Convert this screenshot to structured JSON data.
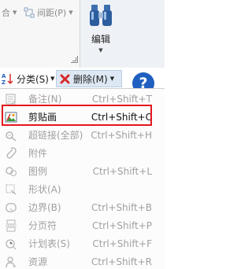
{
  "ribbon": {
    "group_left_label": "合",
    "spacing_label": "间距(P)",
    "edit_label": "编辑"
  },
  "toolbar": {
    "sort_label": "分类(S)",
    "delete_label": "删除(M)",
    "help_label": "?"
  },
  "menu": {
    "items": [
      {
        "label": "备注(N)",
        "shortcut": "Ctrl+Shift+T",
        "icon": "note-icon",
        "enabled": false
      },
      {
        "label": "剪贴画",
        "shortcut": "Ctrl+Shift+C",
        "icon": "clipart-icon",
        "enabled": true
      },
      {
        "label": "超链接(全部)",
        "shortcut": "Ctrl+Shift+H",
        "icon": "hyperlink-icon",
        "enabled": false
      },
      {
        "label": "附件",
        "shortcut": "",
        "icon": "attachment-icon",
        "enabled": false
      },
      {
        "label": "图例",
        "shortcut": "Ctrl+Shift+L",
        "icon": "legend-icon",
        "enabled": false
      },
      {
        "label": "形状(A)",
        "shortcut": "",
        "icon": "shape-icon",
        "enabled": false
      },
      {
        "label": "边界(B)",
        "shortcut": "Ctrl+Shift+B",
        "icon": "boundary-icon",
        "enabled": false
      },
      {
        "label": "分页符",
        "shortcut": "Ctrl+Shift+P",
        "icon": "page-break-icon",
        "enabled": false
      },
      {
        "label": "计划表(S)",
        "shortcut": "Ctrl+Shift+F",
        "icon": "schedule-icon",
        "enabled": false
      },
      {
        "label": "资源",
        "shortcut": "Ctrl+Shift+R",
        "icon": "resource-icon",
        "enabled": false
      }
    ]
  },
  "colors": {
    "highlight_border": "#e5161e",
    "delete_red": "#d62b2b",
    "help_blue": "#1f5fbf"
  }
}
